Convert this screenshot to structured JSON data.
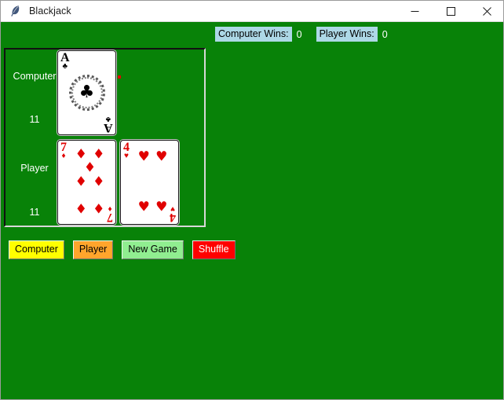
{
  "window": {
    "title": "Blackjack",
    "icon": "python-feather-icon",
    "background_color": "#088208",
    "controls": [
      {
        "name": "minimize",
        "glyph": "—"
      },
      {
        "name": "maximize",
        "glyph": "☐"
      },
      {
        "name": "close",
        "glyph": "✕"
      }
    ]
  },
  "scoreboard": {
    "computer": {
      "label": "Computer Wins:",
      "value": "0"
    },
    "player": {
      "label": "Player Wins:",
      "value": "0"
    },
    "label_background": "#add8e6",
    "value_color": "#ffffff"
  },
  "table": {
    "hands": [
      {
        "name": "Computer",
        "score": "11",
        "cards": [
          {
            "rank": "A",
            "suit": "clubs",
            "suit_glyph": "♣",
            "color": "#000000",
            "layout": "ace"
          }
        ]
      },
      {
        "name": "Player",
        "score": "11",
        "cards": [
          {
            "rank": "7",
            "suit": "diamonds",
            "suit_glyph": "♦",
            "color": "#e00000",
            "layout": "seven"
          },
          {
            "rank": "4",
            "suit": "hearts",
            "suit_glyph": "♥",
            "color": "#e00000",
            "layout": "four"
          }
        ]
      }
    ]
  },
  "buttons": [
    {
      "label": "Computer",
      "background": "#ffff00",
      "text_color": "#000000"
    },
    {
      "label": "Player",
      "background": "#ffa52c",
      "text_color": "#000000"
    },
    {
      "label": "New Game",
      "background": "#90ee90",
      "text_color": "#000000"
    },
    {
      "label": "Shuffle",
      "background": "#fe0000",
      "text_color": "#ffffff"
    }
  ],
  "pip_layouts": {
    "four": [
      [
        30,
        16
      ],
      [
        74,
        16
      ],
      [
        30,
        84
      ],
      [
        74,
        84
      ]
    ],
    "seven": [
      [
        30,
        13
      ],
      [
        74,
        13
      ],
      [
        52,
        31
      ],
      [
        30,
        50
      ],
      [
        74,
        50
      ],
      [
        30,
        87
      ],
      [
        74,
        87
      ]
    ]
  }
}
